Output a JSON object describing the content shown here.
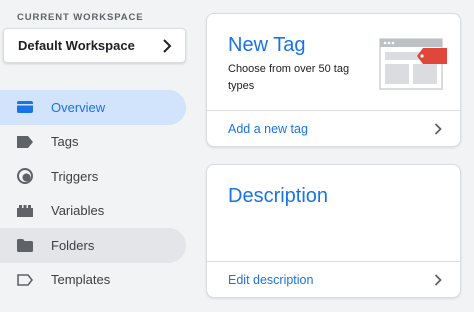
{
  "workspace": {
    "section_label": "CURRENT WORKSPACE",
    "current": "Default Workspace"
  },
  "nav": {
    "items": [
      {
        "label": "Overview",
        "icon": "overview-icon",
        "state": "active"
      },
      {
        "label": "Tags",
        "icon": "tag-icon",
        "state": "normal"
      },
      {
        "label": "Triggers",
        "icon": "trigger-icon",
        "state": "normal"
      },
      {
        "label": "Variables",
        "icon": "variables-icon",
        "state": "normal"
      },
      {
        "label": "Folders",
        "icon": "folder-icon",
        "state": "hover"
      },
      {
        "label": "Templates",
        "icon": "template-icon",
        "state": "normal"
      }
    ]
  },
  "new_tag_card": {
    "title": "New Tag",
    "description": "Choose from over 50 tag types",
    "action": "Add a new tag",
    "illustration": "tag-illustration-icon"
  },
  "description_card": {
    "title": "Description",
    "action": "Edit description"
  },
  "colors": {
    "accent": "#1a73e8",
    "active_bg": "#d2e3fc",
    "page_bg": "#f1f3f4",
    "tag_red": "#e0463a"
  }
}
